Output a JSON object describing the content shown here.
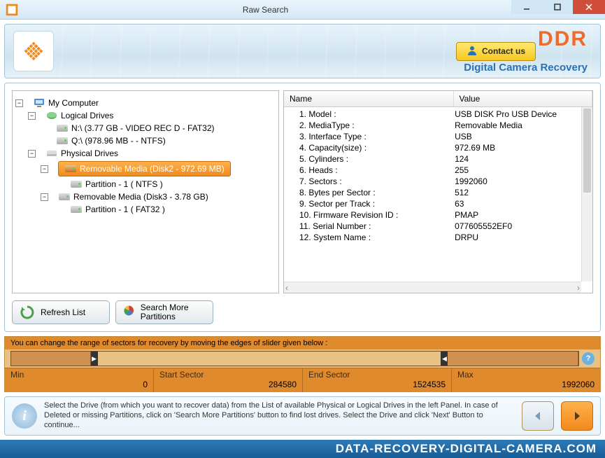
{
  "window": {
    "title": "Raw Search"
  },
  "header": {
    "contact_label": "Contact us",
    "ddr": "DDR",
    "tagline": "Digital Camera Recovery"
  },
  "tree": {
    "root": "My Computer",
    "logical_label": "Logical Drives",
    "logical": [
      "N:\\ (3.77 GB - VIDEO REC D - FAT32)",
      "Q:\\ (978.96 MB -  - NTFS)"
    ],
    "physical_label": "Physical Drives",
    "phys1": "Removable Media (Disk2 - 972.69 MB)",
    "phys1_part": "Partition - 1 ( NTFS )",
    "phys2": "Removable Media (Disk3 - 3.78 GB)",
    "phys2_part": "Partition - 1 ( FAT32 )"
  },
  "details": {
    "col_name": "Name",
    "col_value": "Value",
    "rows": [
      {
        "n": "1. Model :",
        "v": "USB DISK Pro USB Device"
      },
      {
        "n": "2. MediaType :",
        "v": "Removable Media"
      },
      {
        "n": "3. Interface Type :",
        "v": "USB"
      },
      {
        "n": "4. Capacity(size) :",
        "v": "972.69 MB"
      },
      {
        "n": "5. Cylinders :",
        "v": "124"
      },
      {
        "n": "6. Heads :",
        "v": "255"
      },
      {
        "n": "7. Sectors :",
        "v": "1992060"
      },
      {
        "n": "8. Bytes per Sector :",
        "v": "512"
      },
      {
        "n": "9. Sector per Track :",
        "v": "63"
      },
      {
        "n": "10. Firmware Revision ID :",
        "v": "PMAP"
      },
      {
        "n": "11. Serial Number :",
        "v": "077605552EF0"
      },
      {
        "n": "12. System Name :",
        "v": "DRPU"
      }
    ]
  },
  "buttons": {
    "refresh": "Refresh List",
    "search_more": "Search More Partitions"
  },
  "sector": {
    "message": "You can change the range of sectors for recovery by moving the edges of slider given below :",
    "min_label": "Min",
    "min_value": "0",
    "start_label": "Start Sector",
    "start_value": "284580",
    "end_label": "End Sector",
    "end_value": "1524535",
    "max_label": "Max",
    "max_value": "1992060"
  },
  "instructions": "Select the Drive (from which you want to recover data) from the List of available Physical or Logical Drives in the left Panel. In case of Deleted or missing Partitions, click on 'Search More Partitions' button to find lost drives. Select the Drive and click 'Next' Button to continue...",
  "brand": "DATA-RECOVERY-DIGITAL-CAMERA.COM"
}
